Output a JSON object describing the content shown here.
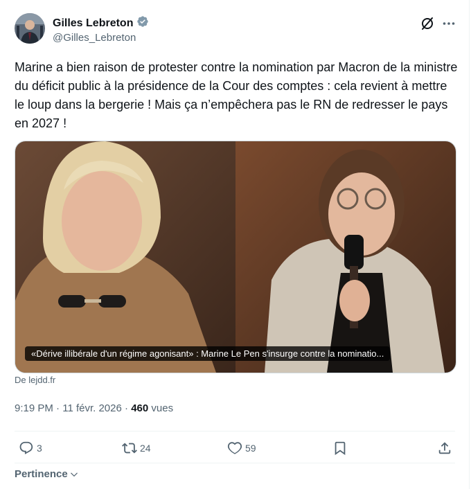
{
  "author": {
    "name": "Gilles Lebreton",
    "handle": "@Gilles_Lebreton",
    "verified": true
  },
  "tweet": {
    "text": "Marine a bien raison de protester contre la nomination par Macron de la ministre du déficit public à la présidence de la Cour des comptes : cela revient à mettre le loup dans la bergerie ! Mais ça n’empêchera pas le RN de redresser le pays en 2027 !"
  },
  "media": {
    "caption": "«Dérive illibérale d'un régime agonisant» : Marine Le Pen s'insurge contre la nominatio...",
    "source": "De lejdd.fr"
  },
  "meta": {
    "time": "9:19 PM",
    "separator1": " · ",
    "date": "11 févr. 2026",
    "separator2": " · ",
    "views_count": "460",
    "views_label": " vues"
  },
  "actions": {
    "replies": "3",
    "reposts": "24",
    "likes": "59"
  },
  "sort": {
    "label": "Pertinence"
  },
  "colors": {
    "verified": "#829aab",
    "text": "#0f1419",
    "muted": "#536471",
    "border": "#eff3f4"
  },
  "icons": [
    "grok-icon",
    "more-icon",
    "reply-icon",
    "repost-icon",
    "like-icon",
    "bookmark-icon",
    "share-icon",
    "chevron-down-icon",
    "verified-badge-icon"
  ]
}
